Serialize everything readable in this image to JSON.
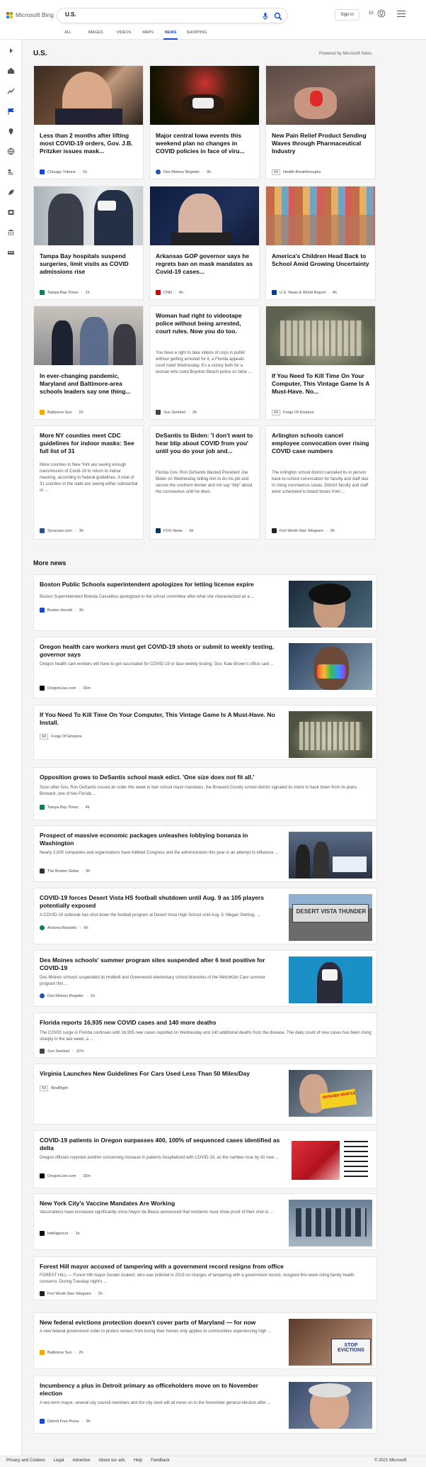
{
  "brand": {
    "logo_text": "Microsoft Bing",
    "colors": [
      "#f25022",
      "#7fba00",
      "#00a4ef",
      "#ffb900"
    ]
  },
  "search": {
    "value": "U.S."
  },
  "header": {
    "signin": "Sign in",
    "points": "10"
  },
  "tabs": [
    "ALL",
    "IMAGES",
    "VIDEOS",
    "MAPS",
    "NEWS",
    "SHOPPING"
  ],
  "active_tab": "NEWS",
  "accent": "#174ae4",
  "section": {
    "title": "U.S.",
    "powered": "Powered by Microsoft News"
  },
  "cards": [
    {
      "title": "Less than 2 months after lifting most COVID-19 orders, Gov. J.B. Pritzker issues mask...",
      "snippet": "",
      "source": "Chicago Tribune",
      "time": "1h",
      "ad": ""
    },
    {
      "title": "Major central Iowa events this weekend plan no changes in COVID policies in face of viru...",
      "snippet": "",
      "source": "Des Moines Register",
      "time": "3h",
      "ad": ""
    },
    {
      "title": "New Pain Relief Product Sending Waves through Pharmaceutical Industry",
      "snippet": "",
      "source": "Health Breakthroughs",
      "time": "",
      "ad": "Ad"
    },
    {
      "title": "Tampa Bay hospitals suspend surgeries, limit visits as COVID admissions rise",
      "snippet": "",
      "source": "Tampa Bay Times",
      "time": "1h",
      "ad": ""
    },
    {
      "title": "Arkansas GOP governor says he regrets ban on mask mandates as Covid-19 cases...",
      "snippet": "",
      "source": "CNN",
      "time": "4h",
      "ad": ""
    },
    {
      "title": "America's Children Head Back to School Amid Growing Uncertainty",
      "snippet": "",
      "source": "U.S. News & World Report",
      "time": "4h",
      "ad": ""
    },
    {
      "title": "In ever-changing pandemic, Maryland and Baltimore-area schools leaders say one thing...",
      "snippet": "",
      "source": "Baltimore Sun",
      "time": "2h",
      "ad": ""
    },
    {
      "title": "Woman had right to videotape police without being arrested, court rules. Now you do too.",
      "snippet": "You have a right to take videos of cops in public without getting arrested for it, a Florida appeals court ruled Wednesday. It's a victory both for a woman who sued Boynton Beach police on false ...",
      "source": "Sun Sentinel",
      "time": "2h",
      "ad": ""
    },
    {
      "title": "If You Need To Kill Time On Your Computer, This Vintage Game Is A Must-Have. No...",
      "snippet": "",
      "source": "Forge Of Empires",
      "time": "",
      "ad": "Ad"
    },
    {
      "title": "More NY counties meet CDC guidelines for indoor masks: See full list of 31",
      "snippet": "More counties in New York are seeing enough transmission of Covid-19 to return to indoor masking, according to federal guidelines. A total of 31 counties in the state are seeing either substantial or ...",
      "source": "Syracuse.com",
      "time": "3h",
      "ad": ""
    },
    {
      "title": "DeSantis to Biden: 'I don't want to hear blip about COVID from you' until you do your job and...",
      "snippet": "Florida Gov. Ron DeSantis blasted President Joe Biden on Wednesday telling him to do his job and secure the southern border and not say \"blip\" about the coronavirus until he does.",
      "source": "FOX News",
      "time": "5h",
      "ad": ""
    },
    {
      "title": "Arlington schools cancel employee convocation over rising COVID case numbers",
      "snippet": "The Arlington school district canceled its in person back-to-school convocation for faculty and staff due to rising coronavirus cases. District faculty and staff were scheduled to board buses from ...",
      "source": "Fort Worth Star-Telegram",
      "time": "3h",
      "ad": ""
    }
  ],
  "more_news": {
    "title": "More news",
    "items": [
      {
        "title": "Boston Public Schools superintendent apologizes for letting license expire",
        "snippet": "Boston Superintendent Brenda Cassellius apologized to the school committee after what she characterized as a ...",
        "source": "Boston Herald",
        "time": "3h",
        "ad": ""
      },
      {
        "title": "Oregon health care workers must get COVID-19 shots or submit to weekly testing, governor says",
        "snippet": "Oregon health care workers will have to get vaccinated for COVID-19 or face weekly testing, Gov. Kate Brown's office said ...",
        "source": "OregonLive.com",
        "time": "33m",
        "ad": ""
      },
      {
        "title": "If You Need To Kill Time On Your Computer, This Vintage Game Is A Must-Have. No Install.",
        "snippet": "",
        "source": "Forge Of Empires",
        "time": "",
        "ad": "Ad"
      },
      {
        "title": "Opposition grows to DeSantis school mask edict. 'One size does not fit all.'",
        "snippet": "Soon after Gov. Ron DeSantis issued an order this week to ban school mask mandates, the Broward County school district signaled its intent to back down from its plans. Broward, one of two Florida ...",
        "source": "Tampa Bay Times",
        "time": "4h",
        "ad": ""
      },
      {
        "title": "Prospect of massive economic packages unleashes lobbying bonanza in Washington",
        "snippet": "Nearly 2,000 companies and organizations have lobbied Congress and the administration this year in an attempt to influence ...",
        "source": "The Boston Globe",
        "time": "5h",
        "ad": ""
      },
      {
        "title": "COVID-19 forces Desert Vista HS football shutdown until Aug. 9 as 105 players potentially exposed",
        "snippet": "A COVID-19 outbreak has shut down the football program at Desert Vista High School until Aug. 9. Megan Sterling, ...",
        "source": "Arizona Republic",
        "time": "6h",
        "ad": ""
      },
      {
        "title": "Des Moines schools' summer program sites suspended after 6 test positive for COVID-19",
        "snippet": "Des Moines schools suspended its Hubbell and Greenwood elementary school branches of the MetroKids Care summer program this ...",
        "source": "Des Moines Register",
        "time": "1h",
        "ad": ""
      },
      {
        "title": "Florida reports 16,935 new COVID cases and 140 more deaths",
        "snippet": "The COVID surge in Florida continues with 16,935 new cases reported on Wednesday and 140 additional deaths from the disease. The daily count of new cases has been rising sharply in the last week, a ...",
        "source": "Sun Sentinel",
        "time": "37m",
        "ad": ""
      },
      {
        "title": "Virginia Launches New Guidelines For Cars Used Less Than 50 Miles/Day",
        "snippet": "",
        "source": "BindRight",
        "time": "",
        "ad": "Ad"
      },
      {
        "title": "COVID-19 patients in Oregon surpasses 400, 100% of sequenced cases identified as delta",
        "snippet": "Oregon officials reported another concerning increase in patients hospitalized with COVID-19, as the number rose by 43 new ...",
        "source": "OregonLive.com",
        "time": "33m",
        "ad": ""
      },
      {
        "title": "New York City's Vaccine Mandates Are Working",
        "snippet": "Vaccinations have increased significantly since Mayor de Blasio announced that residents must show proof of their shot to ...",
        "source": "Intelligencer",
        "time": "1h",
        "ad": ""
      },
      {
        "title": "Forest Hill mayor accused of tampering with a government record resigns from office",
        "snippet": "FOREST HILL — Forest Hill mayor Gerald Joubert, who was indicted in 2019 on charges of tampering with a government record, resigned this week citing family health concerns. During Tuesday night's ...",
        "source": "Fort Worth Star-Telegram",
        "time": "2h",
        "ad": ""
      },
      {
        "title": "New federal evictions protection doesn't cover parts of Maryland — for now",
        "snippet": "A new federal government order to protect renters from losing their homes only applies to communities experiencing high ...",
        "source": "Baltimore Sun",
        "time": "2h",
        "ad": ""
      },
      {
        "title": "Incumbency a plus in Detroit primary as officeholders move on to November election",
        "snippet": "A two-term mayor, several city council members and the city clerk will all move on to the November general election after ...",
        "source": "Detroit Free Press",
        "time": "3h",
        "ad": ""
      }
    ]
  },
  "image_text": {
    "thunder": "DESERT VISTA THUNDER",
    "vaxx": "UNTAXED VEHICLE",
    "stop": "STOP EVICTIONS"
  },
  "footer": {
    "links": [
      "Privacy and Cookies",
      "Legal",
      "Advertise",
      "About our ads",
      "Help",
      "Feedback"
    ],
    "copyright": "© 2021 Microsoft"
  }
}
